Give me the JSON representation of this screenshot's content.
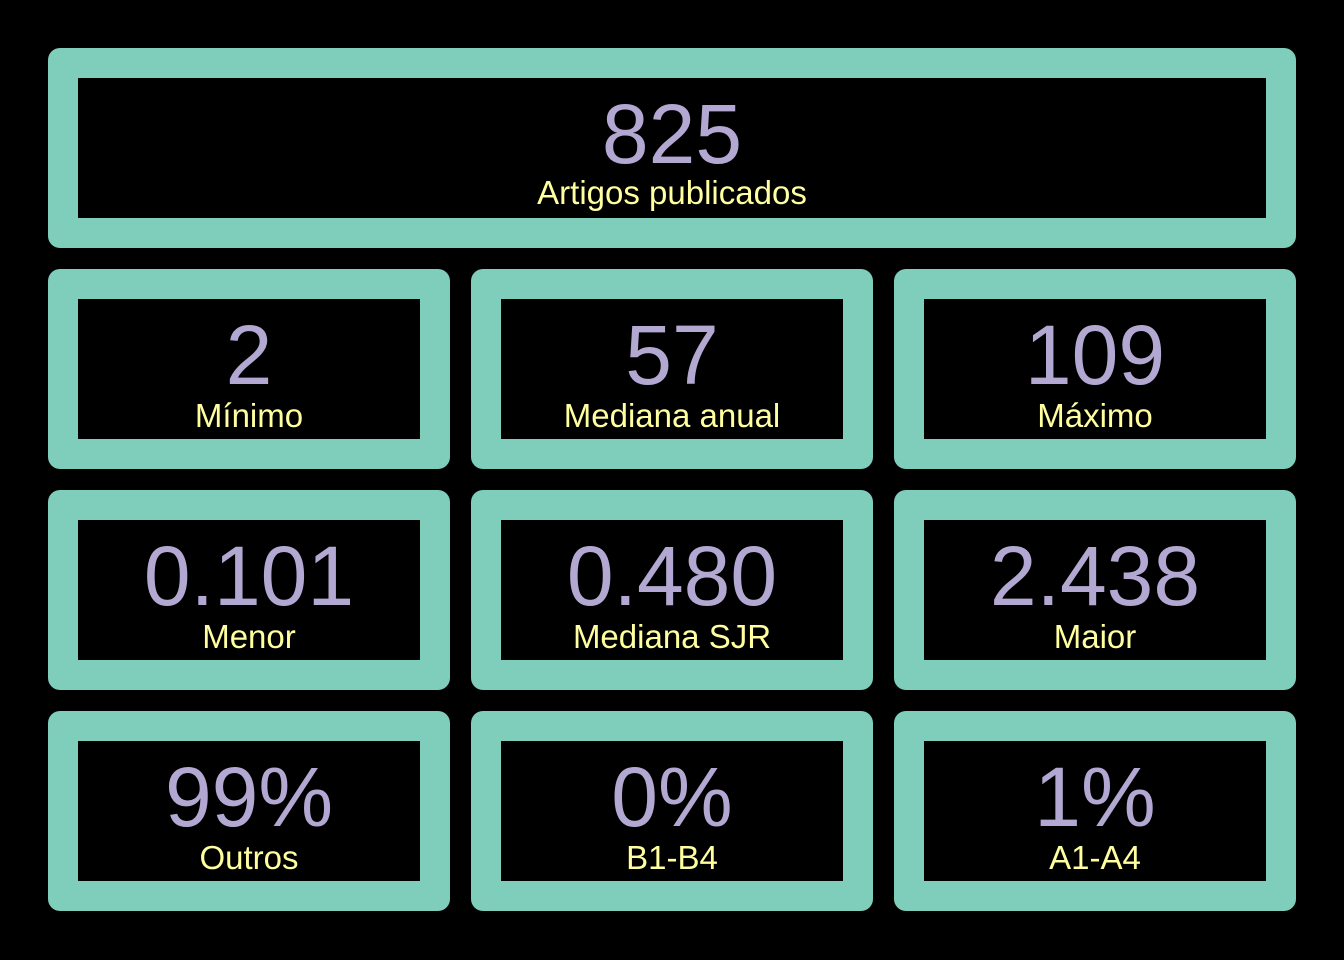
{
  "colors": {
    "background": "#000000",
    "tile_border": "#7fcdbb",
    "value_text": "#b3a8d1",
    "label_text": "#ffffa0"
  },
  "total": {
    "value": "825",
    "label": "Artigos publicados"
  },
  "yearly": {
    "min": {
      "value": "2",
      "label": "Mínimo"
    },
    "median": {
      "value": "57",
      "label": "Mediana anual"
    },
    "max": {
      "value": "109",
      "label": "Máximo"
    }
  },
  "sjr": {
    "lowest": {
      "value": "0.101",
      "label": "Menor"
    },
    "median": {
      "value": "0.480",
      "label": "Mediana SJR"
    },
    "highest": {
      "value": "2.438",
      "label": "Maior"
    }
  },
  "qualis": {
    "others": {
      "value": "99%",
      "label": "Outros"
    },
    "b": {
      "value": "0%",
      "label": "B1-B4"
    },
    "a": {
      "value": "1%",
      "label": "A1-A4"
    }
  }
}
